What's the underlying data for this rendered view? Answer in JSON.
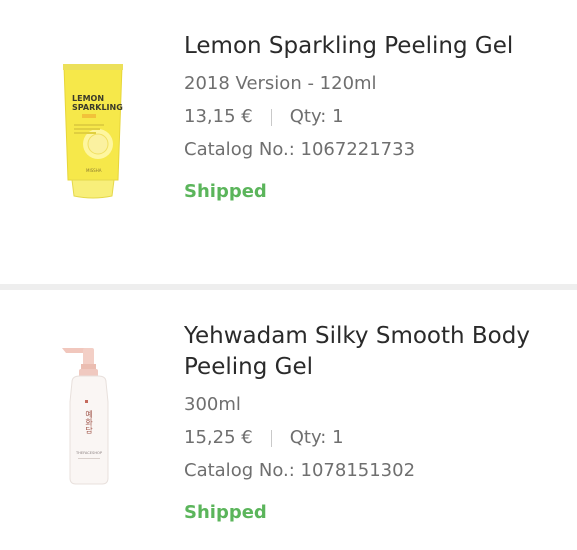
{
  "orders": [
    {
      "name": "Lemon Sparkling Peeling Gel",
      "variant": "2018 Version - 120ml",
      "price": "13,15 €",
      "qty": "Qty: 1",
      "catalog": "Catalog No.: 1067221733",
      "status": "Shipped",
      "image": {
        "brand_line1": "LEMON",
        "brand_line2": "SPARKLING",
        "maker": "MISSHA"
      }
    },
    {
      "name": "Yehwadam Silky Smooth Body Peeling Gel",
      "variant": "300ml",
      "price": "15,25 €",
      "qty": "Qty: 1",
      "catalog": "Catalog No.: 1078151302",
      "status": "Shipped",
      "image": {
        "script": "예화담",
        "maker": "THEFACESHOP"
      }
    }
  ],
  "colors": {
    "status_shipped": "#5bb55b",
    "tube_yellow": "#f5e547",
    "bottle_cap": "#f0c9c0",
    "divider": "#eeeeee"
  }
}
